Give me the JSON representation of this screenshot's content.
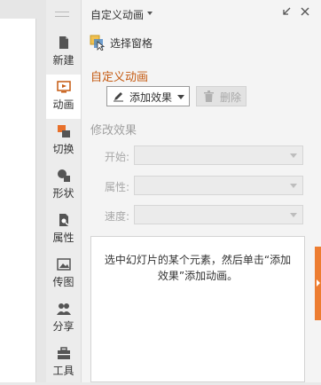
{
  "panel": {
    "title": "自定义动画",
    "select_pane_label": "选择窗格",
    "section_title": "自定义动画",
    "add_effect_label": "添加效果",
    "delete_label": "删除",
    "modify_title": "修改效果",
    "fields": {
      "start_label": "开始:",
      "property_label": "属性:",
      "speed_label": "速度:"
    },
    "hint": "选中幻灯片的某个元素，然后单击“添加效果”添加动画。"
  },
  "toolbar": {
    "items": [
      {
        "label": "新建",
        "icon": "new-icon"
      },
      {
        "label": "动画",
        "icon": "animation-icon",
        "active": true
      },
      {
        "label": "切换",
        "icon": "transition-icon"
      },
      {
        "label": "形状",
        "icon": "shape-icon"
      },
      {
        "label": "属性",
        "icon": "property-icon"
      },
      {
        "label": "传图",
        "icon": "image-icon"
      },
      {
        "label": "分享",
        "icon": "share-icon"
      },
      {
        "label": "工具",
        "icon": "toolbox-icon"
      }
    ]
  },
  "colors": {
    "accent": "#c55a11",
    "side_tab": "#ed7d31"
  }
}
